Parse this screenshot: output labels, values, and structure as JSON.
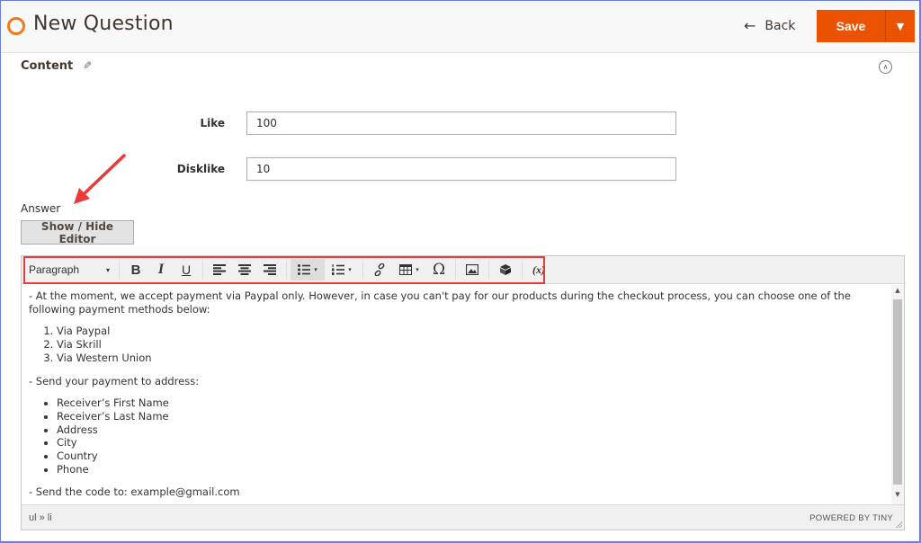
{
  "header": {
    "title": "New Question",
    "back_label": "Back",
    "back_icon": "←",
    "save_label": "Save",
    "save_dropdown_icon": "▼"
  },
  "section": {
    "title": "Content",
    "edit_icon": "✎",
    "collapse_icon": "∧"
  },
  "form": {
    "like": {
      "label": "Like",
      "value": "100"
    },
    "dislike": {
      "label": "Disklike",
      "value": "10"
    },
    "answer_label": "Answer",
    "toggle_editor_label": "Show / Hide Editor"
  },
  "editor": {
    "toolbar": {
      "format_select": "Paragraph",
      "caret": "▾",
      "bold": "B",
      "italic": "I",
      "underline": "U",
      "special_char": "Ω",
      "variable": "(x)"
    },
    "content": {
      "intro": "- At the moment, we accept payment via Paypal only. However, in case you can't pay for our products during the checkout process, you can choose one of the following payment methods below:",
      "payment_methods": [
        "Via Paypal",
        "Via Skrill",
        "Via Western Union"
      ],
      "address_intro": "- Send your payment to address:",
      "address_fields": [
        "Receiver’s First Name",
        "Receiver’s Last Name",
        "Address",
        "City",
        "Country",
        "Phone"
      ],
      "code_line": "- Send the code to: example@gmail.com"
    },
    "status_path": "ul » li",
    "powered_by": "POWERED BY TINY"
  },
  "colors": {
    "accent": "#eb5202",
    "logo": "#f07820",
    "annotation": "#ea3a3a"
  }
}
